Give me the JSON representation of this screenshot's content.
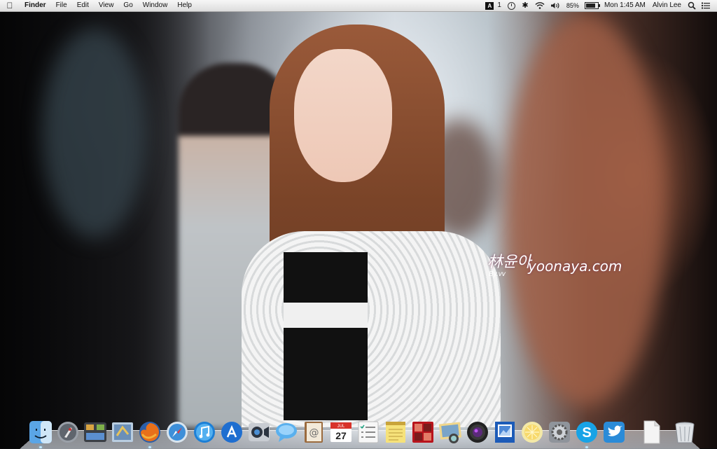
{
  "menubar": {
    "apple_icon": "apple-icon",
    "app_name": "Finder",
    "menus": [
      "File",
      "Edit",
      "View",
      "Go",
      "Window",
      "Help"
    ],
    "status": {
      "adobe_badge": "1",
      "battery_percent": "85%",
      "clock": "Mon 1:45 AM",
      "user": "Alvin Lee"
    }
  },
  "wallpaper": {
    "watermark_name": "林윤아",
    "watermark_site": "yoonaya.com",
    "watermark_by": "By.vv"
  },
  "dock": {
    "items": [
      {
        "name": "finder-icon",
        "running": true
      },
      {
        "name": "launchpad-icon",
        "running": false
      },
      {
        "name": "mission-control-icon",
        "running": false
      },
      {
        "name": "mail-icon",
        "running": false
      },
      {
        "name": "firefox-icon",
        "running": true
      },
      {
        "name": "safari-icon",
        "running": false
      },
      {
        "name": "itunes-icon",
        "running": false
      },
      {
        "name": "app-store-icon",
        "running": false
      },
      {
        "name": "facetime-icon",
        "running": false
      },
      {
        "name": "messages-icon",
        "running": false
      },
      {
        "name": "contacts-icon",
        "running": false
      },
      {
        "name": "calendar-icon",
        "running": false
      },
      {
        "name": "reminders-icon",
        "running": false
      },
      {
        "name": "notes-icon",
        "running": false
      },
      {
        "name": "photo-booth-icon",
        "running": false
      },
      {
        "name": "iphoto-icon",
        "running": false
      },
      {
        "name": "aperture-icon",
        "running": false
      },
      {
        "name": "preview-icon",
        "running": false
      },
      {
        "name": "dashboard-icon",
        "running": false
      },
      {
        "name": "system-preferences-icon",
        "running": false
      },
      {
        "name": "skype-icon",
        "running": true
      },
      {
        "name": "twitter-icon",
        "running": false
      }
    ],
    "calendar_month": "JUL",
    "calendar_day": "27",
    "stacks": [
      "document-stack-icon",
      "trash-icon"
    ]
  }
}
